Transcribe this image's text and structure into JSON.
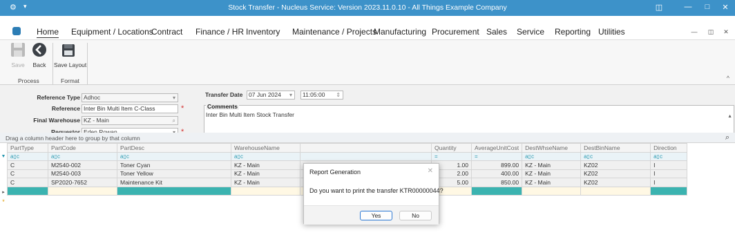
{
  "window": {
    "title": "Stock Transfer - Nucleus Service: Version 2023.11.0.10 - All Things Example Company",
    "sys_icon": "⚙",
    "sys_arrow": "▾",
    "minimize": "—",
    "maximize": "□",
    "close": "✕",
    "restore": "◫"
  },
  "menu": {
    "items": [
      "Home",
      "Equipment / Locations",
      "Contract",
      "Finance / HR",
      "Inventory",
      "Maintenance / Projects",
      "Manufacturing",
      "Procurement",
      "Sales",
      "Service",
      "Reporting",
      "Utilities"
    ],
    "active": "Home",
    "mdi_minimize": "—",
    "mdi_restore": "◫",
    "mdi_close": "✕"
  },
  "ribbon": {
    "save_label": "Save",
    "back_label": "Back",
    "save_layout_label": "Save Layout",
    "group_process": "Process",
    "group_format": "Format",
    "collapse": "^"
  },
  "form": {
    "reference_type_label": "Reference Type",
    "reference_type_value": "Adhoc",
    "reference_label": "Reference",
    "reference_value": "Inter Bin Multi Item C-Class",
    "final_warehouse_label": "Final Warehouse",
    "final_warehouse_value": "KZ - Main",
    "requestor_label": "Requestor",
    "requestor_value": "Eden Rowan",
    "transfer_date_label": "Transfer Date",
    "transfer_date_value": "07 Jun 2024",
    "transfer_time_value": "11:05:00",
    "comments_label": "Comments",
    "comments_value": "Inter Bin Multi Item Stock Transfer",
    "required_mark": "*",
    "dropdown_glyph": "▾",
    "search_glyph": "⌕",
    "spin_glyph": "⇕",
    "scroll_up": "▲",
    "scroll_down": "▼"
  },
  "grid": {
    "group_hint": "Drag a column header here to group by that column",
    "columns": [
      "PartType",
      "PartCode",
      "PartDesc",
      "WarehouseName",
      "",
      "Quantity",
      "AverageUnitCost",
      "DestWhseName",
      "DestBinName",
      "Direction"
    ],
    "filter_glyph": "a▯c",
    "filter_eq": "=",
    "filter_row_icon": "▼",
    "rows": [
      {
        "PartType": "C",
        "PartCode": "M2540-002",
        "PartDesc": "Toner Cyan",
        "WarehouseName": "KZ - Main",
        "Quantity": "1.00",
        "AverageUnitCost": "899.00",
        "DestWhseName": "KZ - Main",
        "DestBinName": "KZ02",
        "Direction": "I"
      },
      {
        "PartType": "C",
        "PartCode": "M2540-003",
        "PartDesc": "Toner Yellow",
        "WarehouseName": "KZ - Main",
        "Quantity": "2.00",
        "AverageUnitCost": "400.00",
        "DestWhseName": "KZ - Main",
        "DestBinName": "KZ02",
        "Direction": "I"
      },
      {
        "PartType": "C",
        "PartCode": "SP2020-7652",
        "PartDesc": "Maintenance Kit",
        "WarehouseName": "KZ - Main",
        "Quantity": "5.00",
        "AverageUnitCost": "850.00",
        "DestWhseName": "KZ - Main",
        "DestBinName": "KZ02",
        "Direction": "I"
      }
    ],
    "current_row_glyph": "▸",
    "new_row_glyph": "*",
    "find_icon": "⌕"
  },
  "dialog": {
    "title": "Report Generation",
    "message": "Do you want to print the transfer KTR00000044?",
    "yes_label": "Yes",
    "no_label": "No",
    "close_glyph": "✕"
  },
  "colors": {
    "titlebar": "#3d92c9",
    "teal_highlight": "#3bb3b0",
    "primary_button_border": "#2b78d3"
  }
}
